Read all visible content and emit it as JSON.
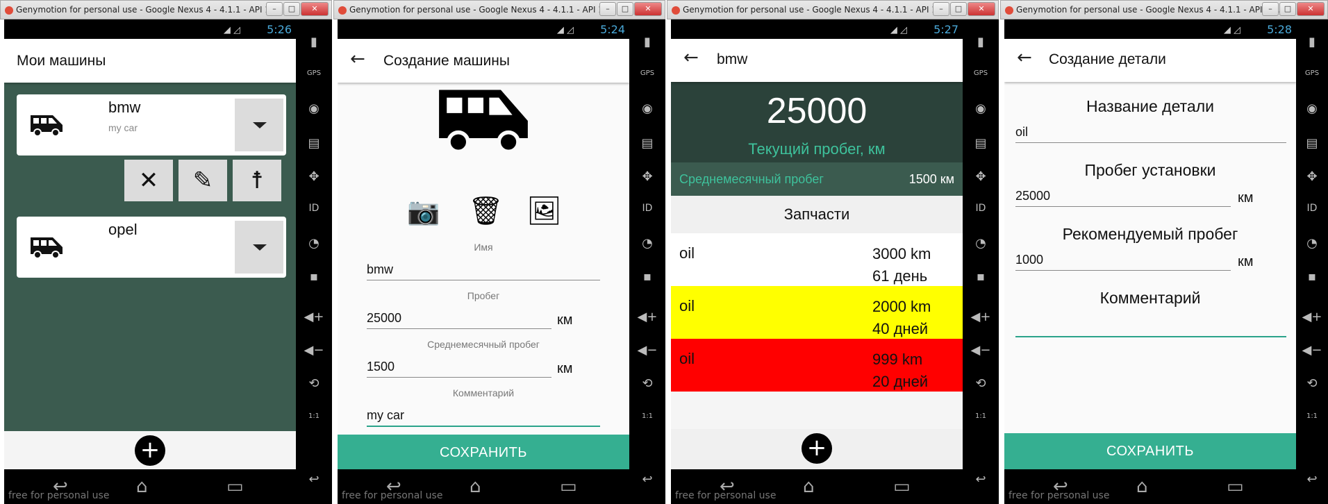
{
  "window_title": "Genymotion for personal use - Google Nexus 4 - 4.1.1 - API 16 ...",
  "free_text": "free for personal use",
  "side_icons": {
    "gps": "GPS",
    "id": "ID",
    "ratio": "1:1"
  },
  "screens": [
    {
      "time": "5:26",
      "title": "Мои машины",
      "cars": [
        {
          "name": "bmw",
          "comment": "my car"
        },
        {
          "name": "opel",
          "comment": ""
        }
      ],
      "fab": "+"
    },
    {
      "time": "5:24",
      "title": "Создание машины",
      "name_label": "Имя",
      "name_value": "bmw",
      "mileage_label": "Пробег",
      "mileage_value": "25000",
      "unit": "км",
      "monthly_label": "Среднемесячный пробег",
      "monthly_value": "1500",
      "comment_label": "Комментарий",
      "comment_value": "my car",
      "save": "СОХРАНИТЬ"
    },
    {
      "time": "5:27",
      "title": "bmw",
      "mileage": "25000",
      "mileage_label": "Текущий пробег, км",
      "monthly_label": "Среднемесячный пробег",
      "monthly_value": "1500 км",
      "parts_header": "Запчасти",
      "parts": [
        {
          "name": "oil",
          "km": "3000 km",
          "days": "61 день",
          "color": "#ffffff"
        },
        {
          "name": "oil",
          "km": "2000 km",
          "days": "40 дней",
          "color": "#ffff00"
        },
        {
          "name": "oil",
          "km": "999 km",
          "days": "20 дней",
          "color": "#ff0000"
        }
      ],
      "fab": "+"
    },
    {
      "time": "5:28",
      "title": "Создание детали",
      "name_label": "Название детали",
      "name_value": "oil",
      "install_label": "Пробег установки",
      "install_value": "25000",
      "unit": "км",
      "recommended_label": "Рекомендуемый пробег",
      "recommended_value": "1000",
      "comment_label": "Комментарий",
      "comment_value": "",
      "save": "СОХРАНИТЬ"
    }
  ],
  "colors": {
    "accent": "#35af91",
    "dark_green": "#3b5b4f",
    "header_green": "#2b423a",
    "mint_text": "#3ec29c"
  }
}
